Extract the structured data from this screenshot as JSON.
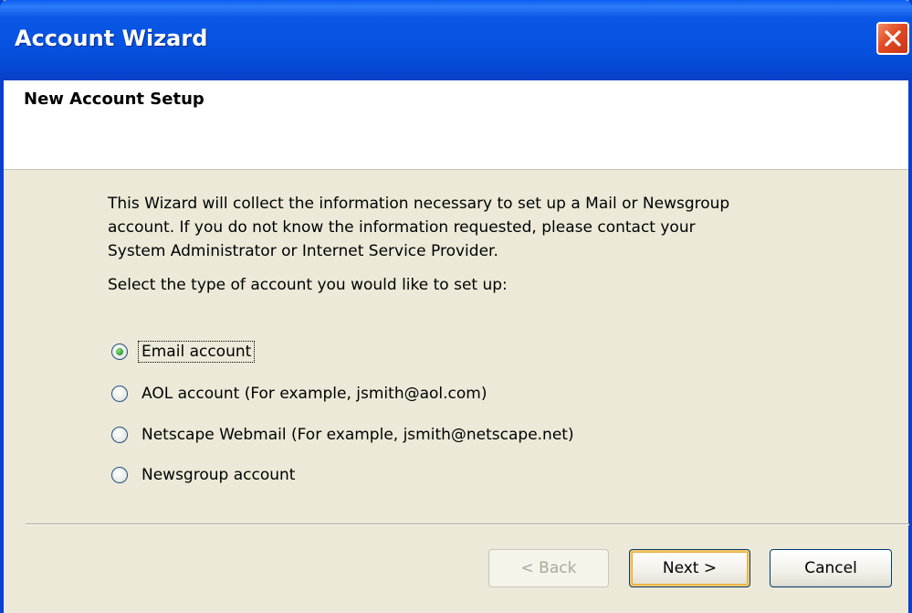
{
  "window": {
    "title": "Account Wizard",
    "accent_color": "#0a57e6",
    "close_icon": "close-icon"
  },
  "header": {
    "title": "New Account Setup"
  },
  "content": {
    "intro_lines": [
      "This Wizard will collect the information necessary to set up a Mail or Newsgroup",
      "account. If you do not know the information requested, please contact your",
      "System Administrator or Internet Service Provider."
    ],
    "prompt": "Select the type of account you would like to set up:",
    "account_types": [
      {
        "label": "Email account",
        "selected": true
      },
      {
        "label": "AOL account (For example, jsmith@aol.com)",
        "selected": false
      },
      {
        "label": "Netscape Webmail (For example, jsmith@netscape.net)",
        "selected": false
      },
      {
        "label": "Newsgroup account",
        "selected": false
      }
    ]
  },
  "buttons": {
    "back": "< Back",
    "next": "Next >",
    "cancel": "Cancel"
  }
}
